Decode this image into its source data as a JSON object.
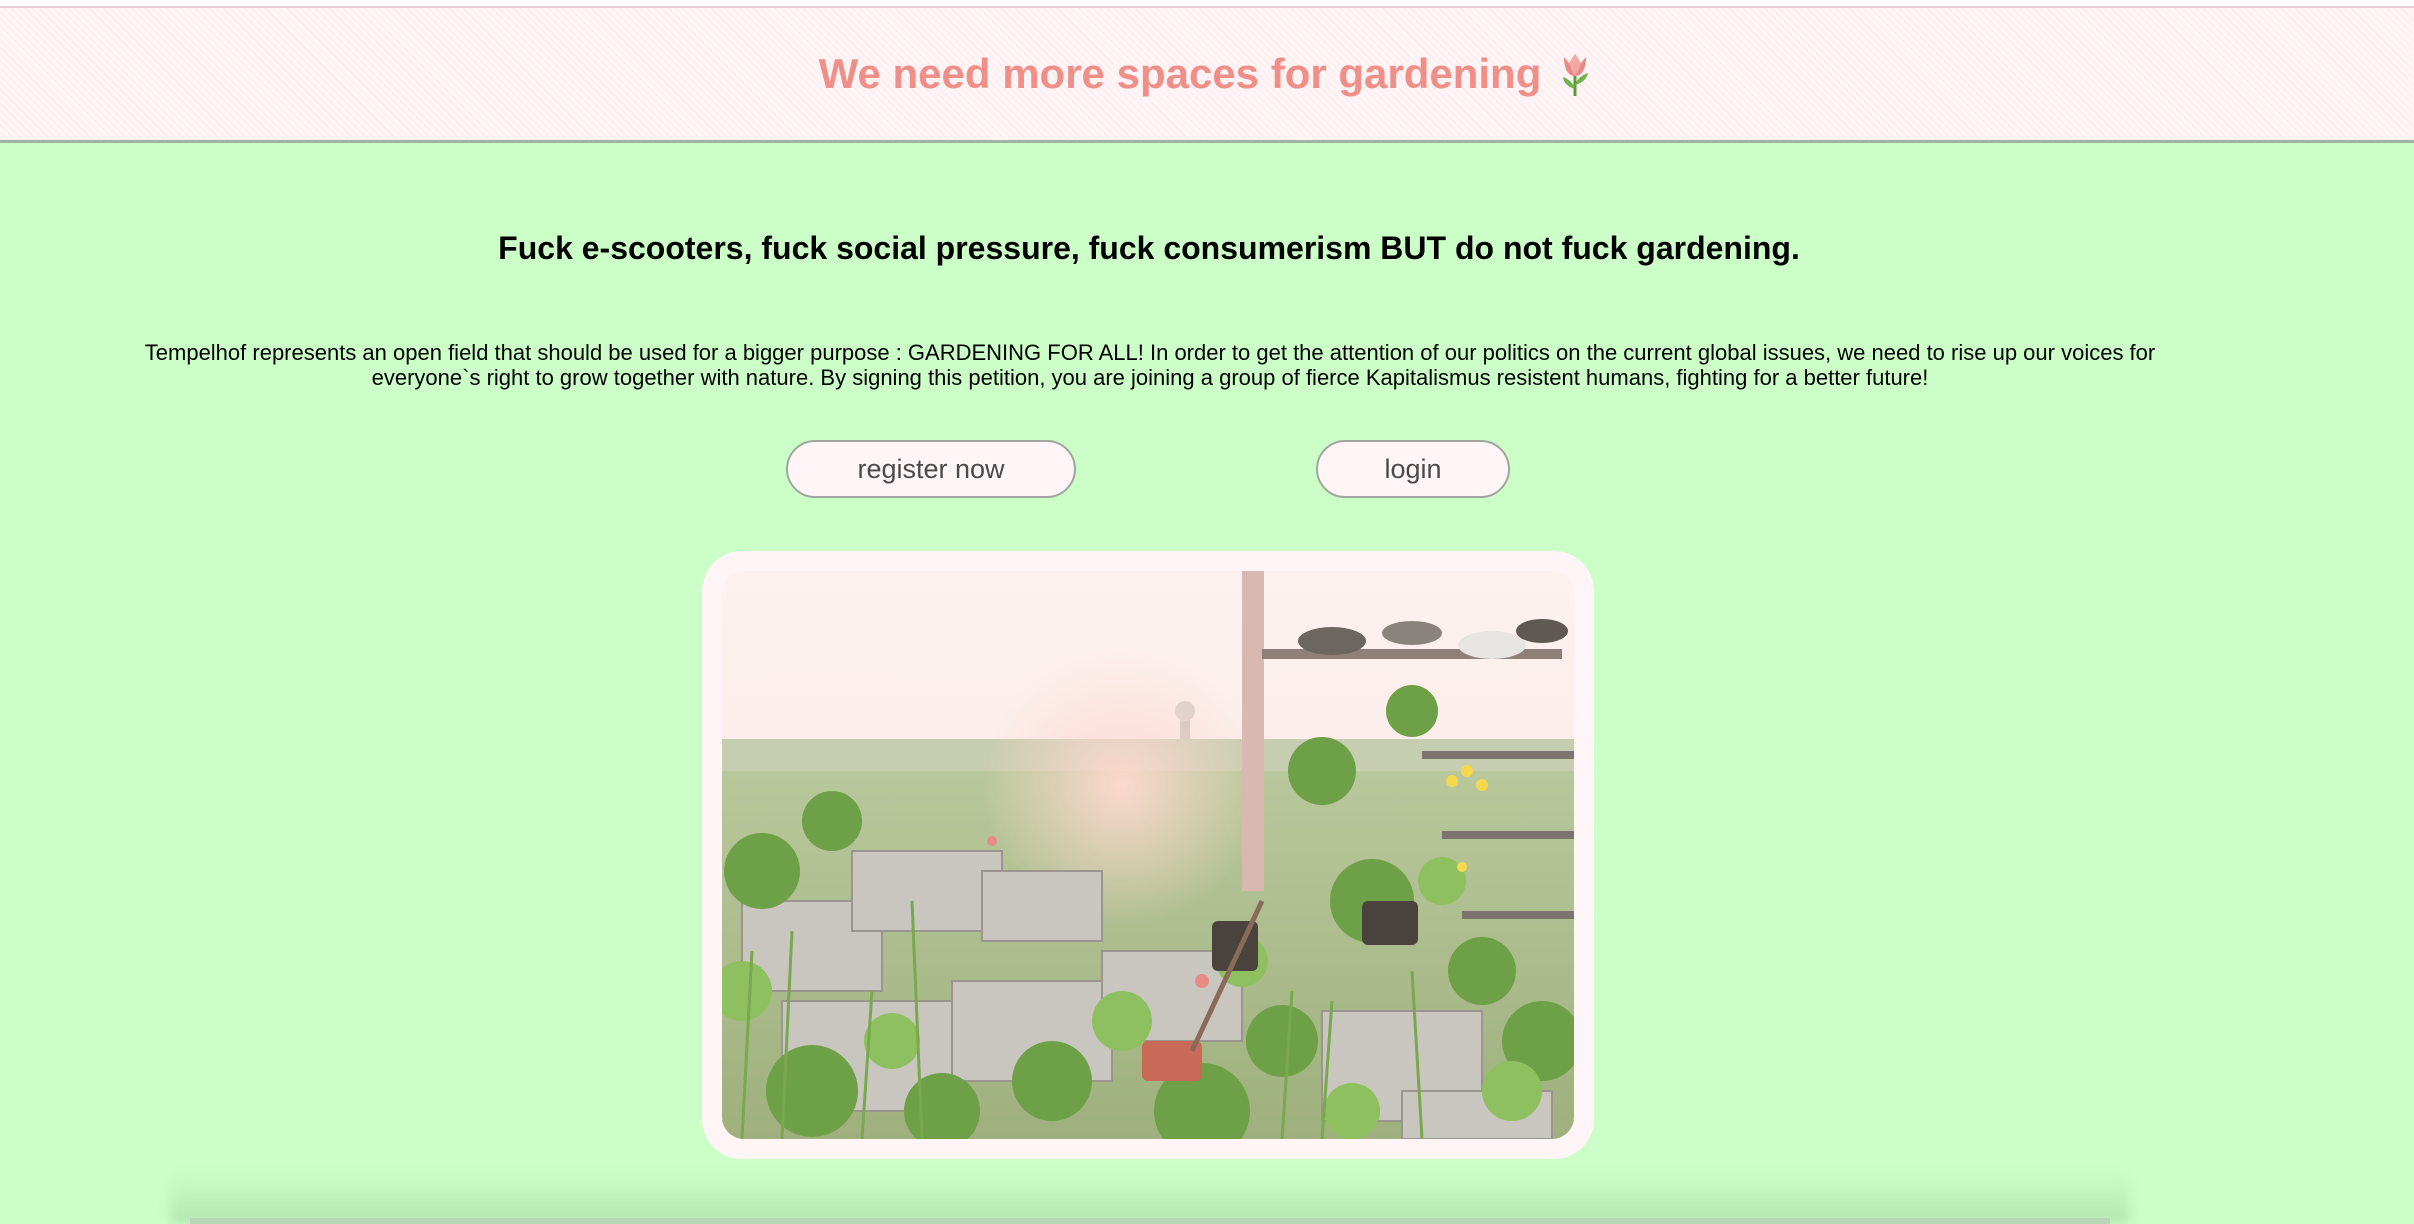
{
  "header": {
    "title": "We need more spaces for gardening",
    "icon": "tulip-icon"
  },
  "main": {
    "slogan": "Fuck e-scooters, fuck social pressure, fuck consumerism BUT do not fuck gardening.",
    "description": "Tempelhof represents an open field that should be used for a bigger purpose : GARDENING FOR ALL! In order to get the attention of our politics on the current global issues, we need to rise up our voices for everyone`s right to grow together with nature. By signing this petition, you are joining a group of fierce Kapitalismus resistent humans, fighting for a better future!",
    "buttons": {
      "register_label": "register now",
      "login_label": "login"
    }
  },
  "colors": {
    "page_background": "#ccffc8",
    "header_background": "#fff4f6",
    "title_color": "#ef8f88",
    "button_background": "#fff4f6",
    "button_border": "#a0a69f"
  }
}
